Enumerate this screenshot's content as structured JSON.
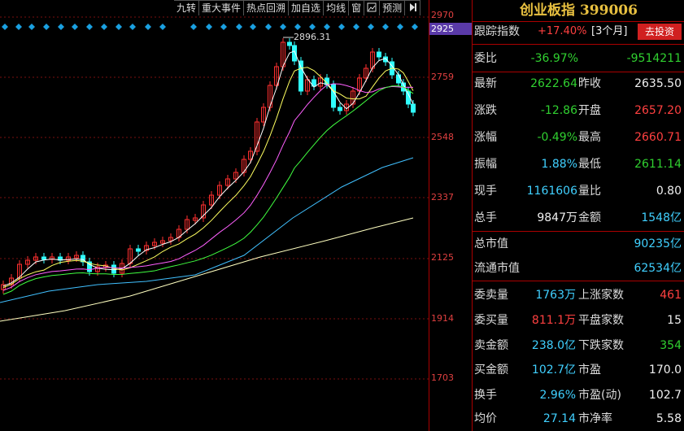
{
  "toolbar": {
    "buttons": [
      "九转",
      "重大事件",
      "热点回溯",
      "加自选",
      "均线",
      "窗",
      "预测"
    ],
    "icon_names": [
      "image-icon",
      "arrow-right-icon"
    ]
  },
  "chart": {
    "peak_label": "2896.31",
    "price_ticks": [
      "2970",
      "2925",
      "2759",
      "2548",
      "2337",
      "2125",
      "1914",
      "1703"
    ],
    "current_price_label": "2925",
    "colors": {
      "up": "#ff3030",
      "down": "#30ffff",
      "ma5": "#ffffff",
      "ma10": "#ffff60",
      "ma20": "#ff60ff",
      "ma30": "#40ff40",
      "ma60": "#40c0ff",
      "ma120": "#ffffc0"
    }
  },
  "panel": {
    "title": "创业板指 399006",
    "track": {
      "label": "跟踪指数",
      "value": "+17.40%",
      "period": "[3个月]",
      "button": "去投资"
    },
    "weibi": {
      "label": "委比",
      "value": "-36.97%",
      "diff": "-9514211"
    },
    "rows": [
      {
        "l1": "最新",
        "v1": "2622.64",
        "l2": "昨收",
        "v2": "2635.50"
      },
      {
        "l1": "涨跌",
        "v1": "-12.86",
        "l2": "开盘",
        "v2": "2657.20"
      },
      {
        "l1": "涨幅",
        "v1": "-0.49%",
        "l2": "最高",
        "v2": "2660.71"
      },
      {
        "l1": "振幅",
        "v1": "1.88%",
        "l2": "最低",
        "v2": "2611.14"
      },
      {
        "l1": "现手",
        "v1": "1161606",
        "l2": "量比",
        "v2": "0.80"
      },
      {
        "l1": "总手",
        "v1": "9847万",
        "l2": "金额",
        "v2": "1548亿"
      }
    ],
    "market_cap": {
      "label": "总市值",
      "value": "90235亿"
    },
    "float_cap": {
      "label": "流通市值",
      "value": "62534亿"
    },
    "stats": [
      {
        "l1": "委卖量",
        "v1": "1763万",
        "l2": "上涨家数",
        "v2": "461"
      },
      {
        "l1": "委买量",
        "v1": "811.1万",
        "l2": "平盘家数",
        "v2": "15"
      },
      {
        "l1": "卖金额",
        "v1": "238.0亿",
        "l2": "下跌家数",
        "v2": "354"
      },
      {
        "l1": "买金额",
        "v1": "102.7亿",
        "l2": "市盈",
        "v2": "170.0"
      },
      {
        "l1": "换手",
        "v1": "2.96%",
        "l2": "市盈(动)",
        "v2": "102.7"
      },
      {
        "l1": "均价",
        "v1": "27.14",
        "l2": "市净率",
        "v2": "5.58"
      }
    ]
  }
}
